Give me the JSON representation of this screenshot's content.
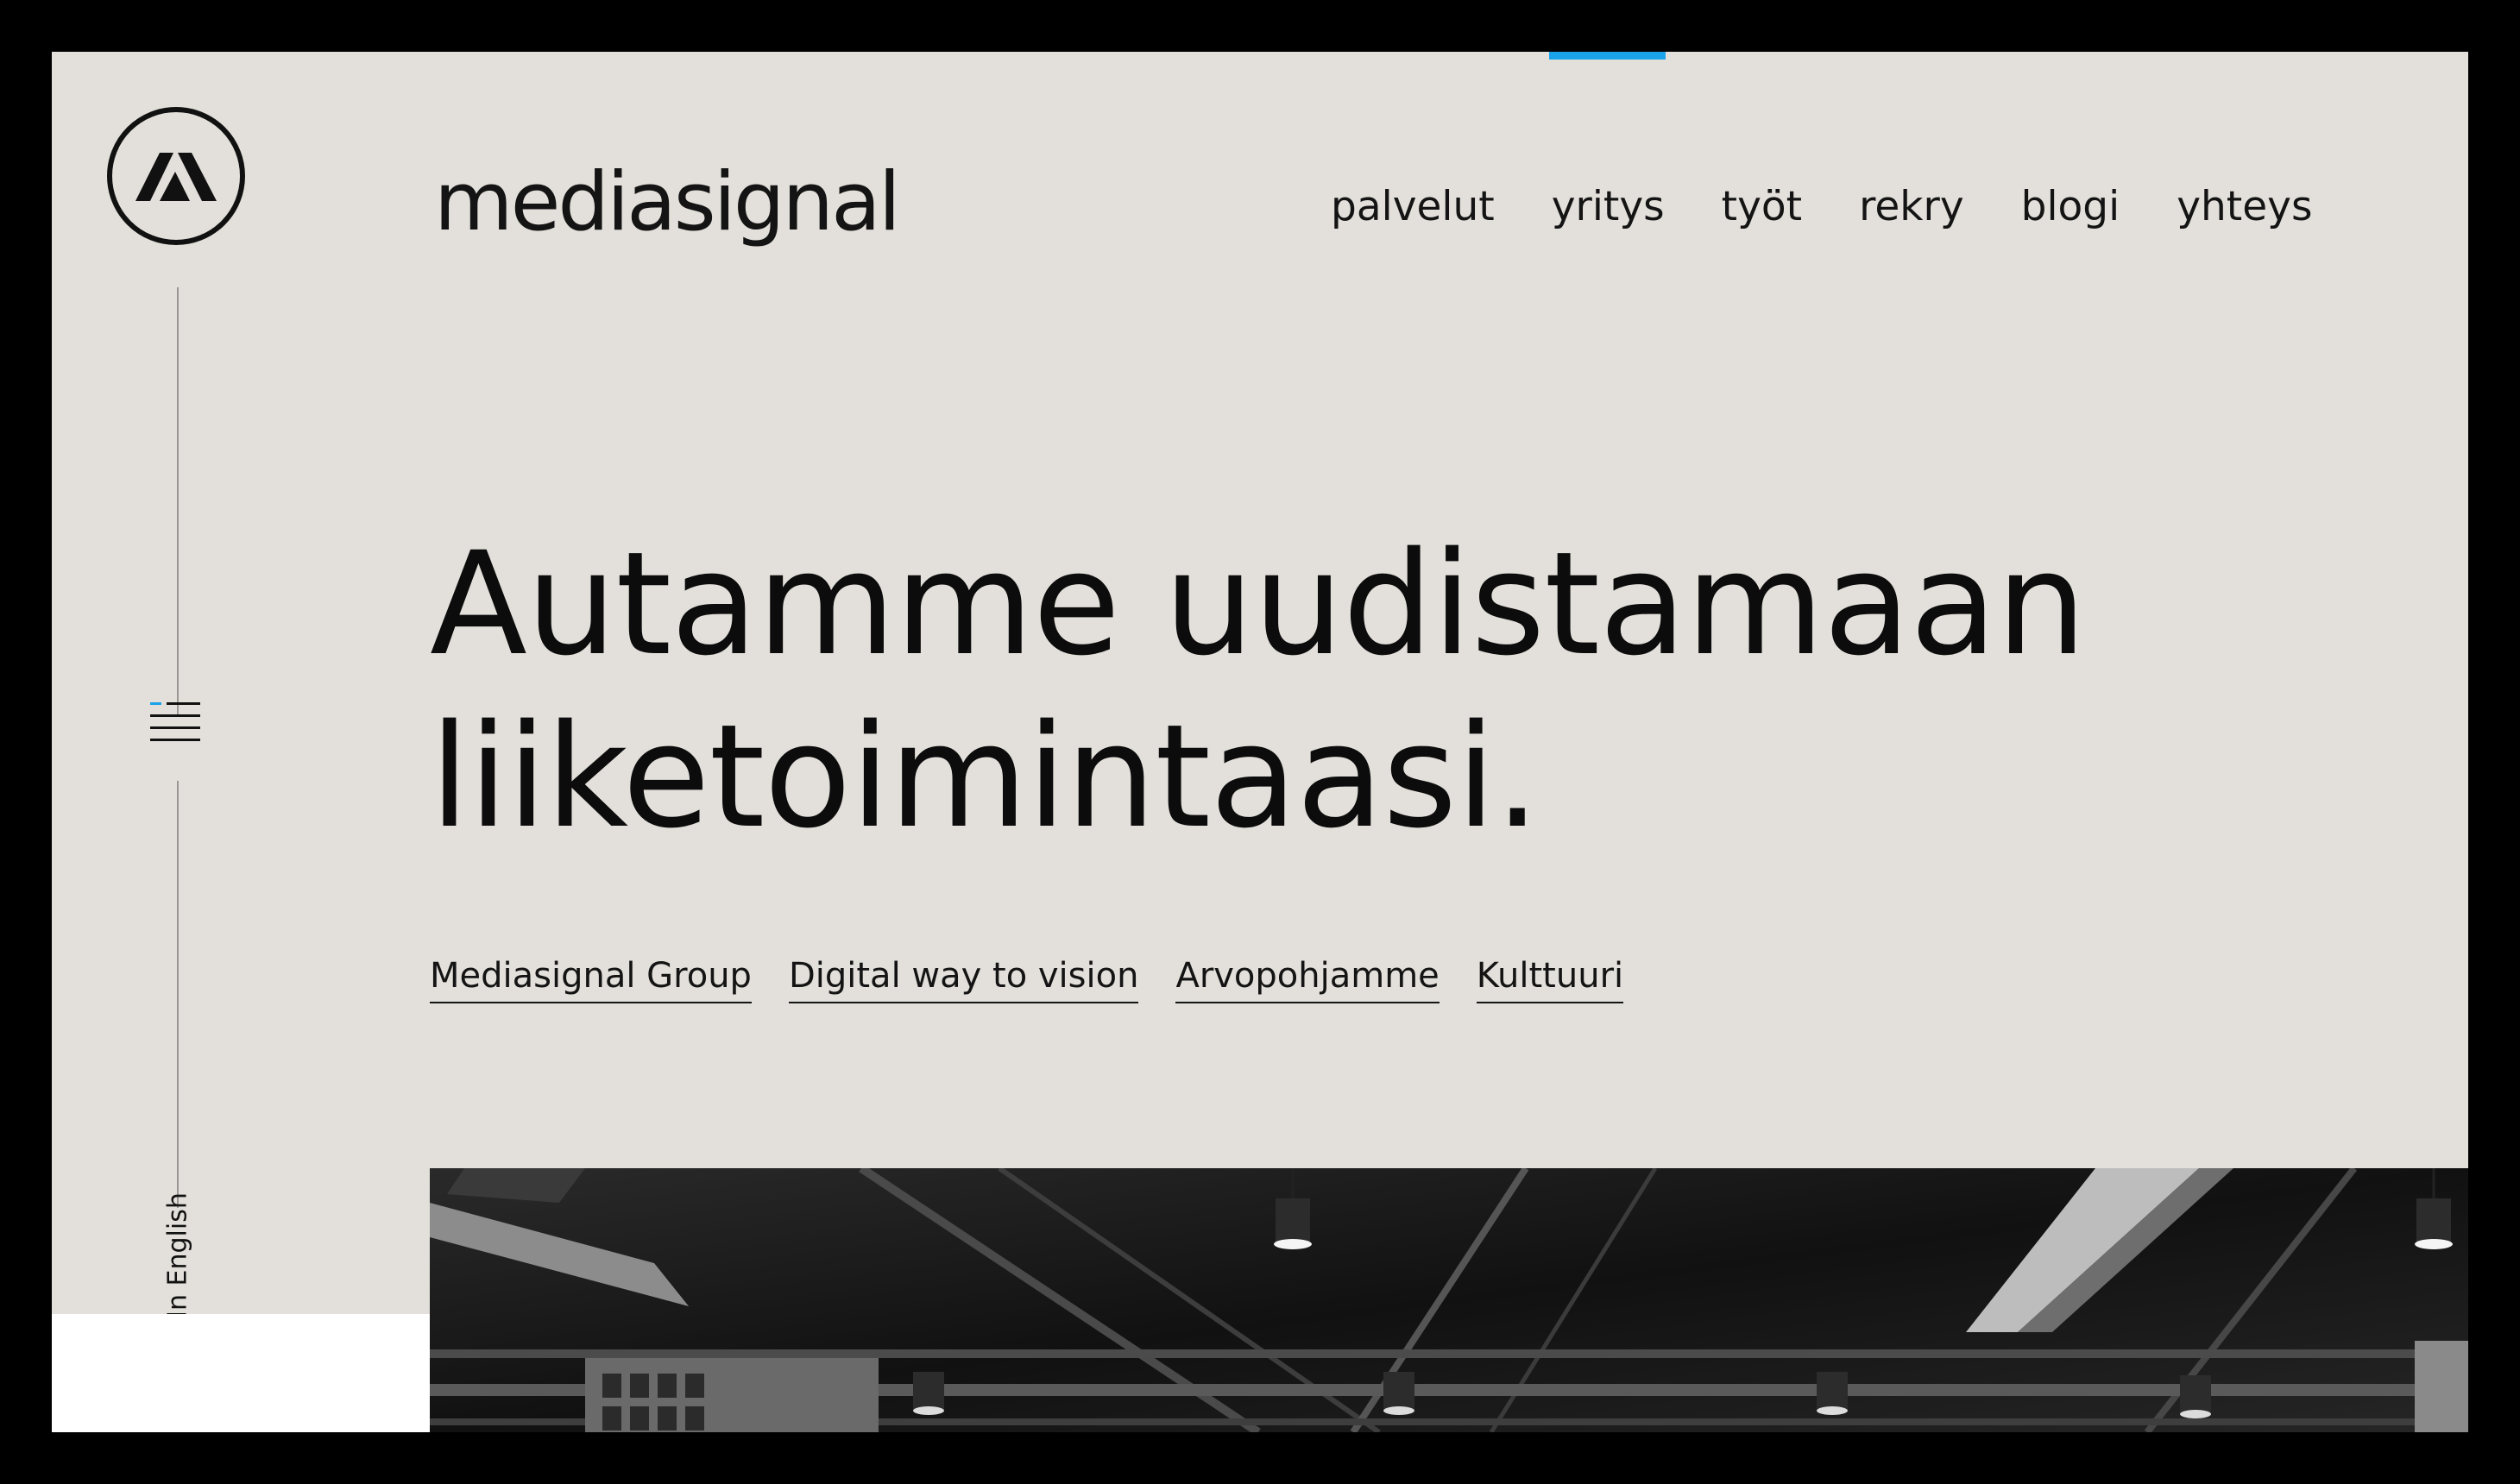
{
  "brand": {
    "name": "mediasignal",
    "logo_icon": "mediasignal-monogram-icon"
  },
  "nav": {
    "items": [
      {
        "label": "palvelut"
      },
      {
        "label": "yritys",
        "active": true
      },
      {
        "label": "työt"
      },
      {
        "label": "rekry"
      },
      {
        "label": "blogi"
      },
      {
        "label": "yhteys"
      }
    ]
  },
  "sidebar": {
    "menu_icon": "menu-icon",
    "language_toggle": "In English"
  },
  "hero": {
    "title_line1": "Autamme uudistamaan",
    "title_line2": "liiketoimintaasi."
  },
  "subnav": {
    "links": [
      "Mediasignal Group",
      "Digital way to vision",
      "Arvopohjamme",
      "Kulttuuri"
    ]
  },
  "colors": {
    "background": "#e3e0db",
    "accent": "#1aa3e8",
    "text": "#111111",
    "frame": "#000000"
  }
}
